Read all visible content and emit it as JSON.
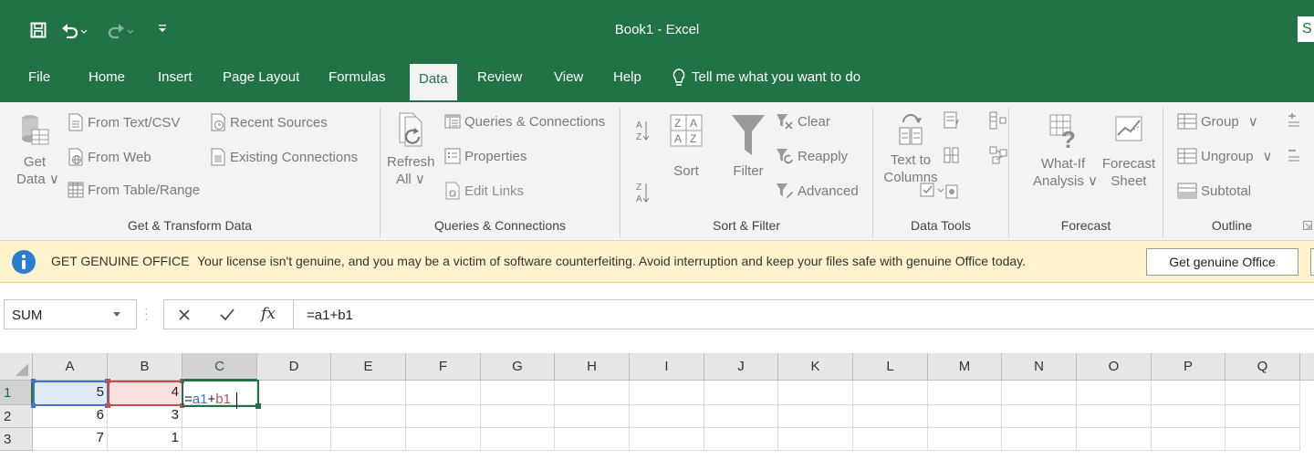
{
  "window": {
    "title": "Book1  -  Excel",
    "signin_label": "S"
  },
  "colors": {
    "accent": "#217346",
    "ref_blue": "#4472c4",
    "ref_red": "#c0504d",
    "message_bg": "#fff3cd",
    "info_icon": "#2b7cd3"
  },
  "tabs": [
    {
      "label": "File"
    },
    {
      "label": "Home"
    },
    {
      "label": "Insert"
    },
    {
      "label": "Page Layout"
    },
    {
      "label": "Formulas"
    },
    {
      "label": "Data",
      "active": true
    },
    {
      "label": "Review"
    },
    {
      "label": "View"
    },
    {
      "label": "Help"
    }
  ],
  "tellme": {
    "label": "Tell me what you want to do"
  },
  "ribbon": {
    "get_transform": {
      "group_label": "Get & Transform Data",
      "get_data": {
        "line1": "Get",
        "line2": "Data ∨"
      },
      "from_text_csv": "From Text/CSV",
      "from_web": "From Web",
      "from_table_range": "From Table/Range",
      "recent_sources": "Recent Sources",
      "existing_connections": "Existing Connections"
    },
    "queries": {
      "group_label": "Queries & Connections",
      "refresh_all": {
        "line1": "Refresh",
        "line2": "All ∨"
      },
      "queries_connections": "Queries & Connections",
      "properties": "Properties",
      "edit_links": "Edit Links"
    },
    "sort_filter": {
      "group_label": "Sort & Filter",
      "sort_az": "A↓Z",
      "sort_za": "Z↓A",
      "sort": "Sort",
      "filter": "Filter",
      "clear": "Clear",
      "reapply": "Reapply",
      "advanced": "Advanced"
    },
    "data_tools": {
      "group_label": "Data Tools",
      "text_to_columns": {
        "line1": "Text to",
        "line2": "Columns"
      }
    },
    "forecast": {
      "group_label": "Forecast",
      "what_if": {
        "line1": "What-If",
        "line2": "Analysis ∨"
      },
      "forecast_sheet": {
        "line1": "Forecast",
        "line2": "Sheet"
      }
    },
    "outline": {
      "group_label": "Outline",
      "group": "Group",
      "ungroup": "Ungroup",
      "subtotal": "Subtotal"
    }
  },
  "message_bar": {
    "title": "GET GENUINE OFFICE",
    "text": "Your license isn't genuine, and you may be a victim of software counterfeiting. Avoid interruption and keep your files safe with genuine Office today.",
    "button": "Get genuine Office"
  },
  "formula_bar": {
    "name_box": "SUM",
    "formula": "=a1+b1",
    "fx_label": "fx"
  },
  "grid": {
    "columns": [
      "A",
      "B",
      "C",
      "D",
      "E",
      "F",
      "G",
      "H",
      "I",
      "J",
      "K",
      "L",
      "M",
      "N",
      "O",
      "P",
      "Q"
    ],
    "rows": [
      "1",
      "2",
      "3"
    ],
    "cells": {
      "A1": "5",
      "B1": "4",
      "A2": "6",
      "B2": "3",
      "A3": "7",
      "B3": "1"
    },
    "editing": {
      "cell": "C1",
      "eq": "=",
      "ref1": "a1",
      "op": "+",
      "ref2": "b1"
    }
  }
}
